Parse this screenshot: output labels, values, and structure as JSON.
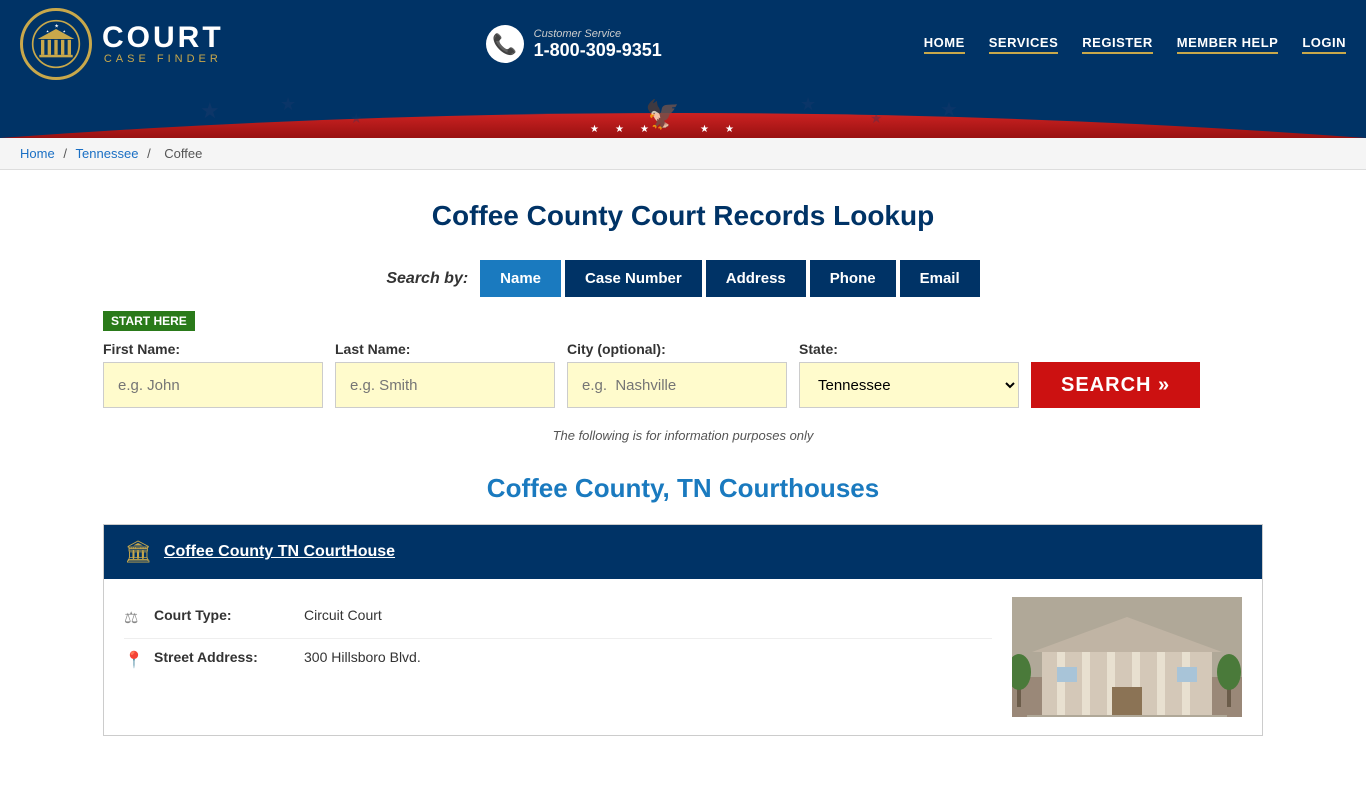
{
  "header": {
    "logo": {
      "court": "COURT",
      "case_finder": "CASE FINDER"
    },
    "customer_service": {
      "label": "Customer Service",
      "phone": "1-800-309-9351"
    },
    "nav": [
      {
        "label": "HOME",
        "href": "#"
      },
      {
        "label": "SERVICES",
        "href": "#"
      },
      {
        "label": "REGISTER",
        "href": "#"
      },
      {
        "label": "MEMBER HELP",
        "href": "#"
      },
      {
        "label": "LOGIN",
        "href": "#"
      }
    ]
  },
  "breadcrumb": {
    "home": "Home",
    "state": "Tennessee",
    "county": "Coffee"
  },
  "page": {
    "title": "Coffee County Court Records Lookup",
    "search_by_label": "Search by:",
    "tabs": [
      {
        "label": "Name",
        "active": true
      },
      {
        "label": "Case Number",
        "active": false
      },
      {
        "label": "Address",
        "active": false
      },
      {
        "label": "Phone",
        "active": false
      },
      {
        "label": "Email",
        "active": false
      }
    ],
    "start_here": "START HERE",
    "form": {
      "first_name_label": "First Name:",
      "first_name_placeholder": "e.g. John",
      "last_name_label": "Last Name:",
      "last_name_placeholder": "e.g. Smith",
      "city_label": "City (optional):",
      "city_placeholder": "e.g.  Nashville",
      "state_label": "State:",
      "state_value": "Tennessee",
      "search_button": "SEARCH »"
    },
    "info_note": "The following is for information purposes only",
    "courthouses_title": "Coffee County, TN Courthouses",
    "courthouse": {
      "name": "Coffee County TN CourtHouse",
      "court_type_label": "Court Type:",
      "court_type_value": "Circuit Court",
      "address_label": "Street Address:",
      "address_value": "300 Hillsboro Blvd."
    }
  }
}
